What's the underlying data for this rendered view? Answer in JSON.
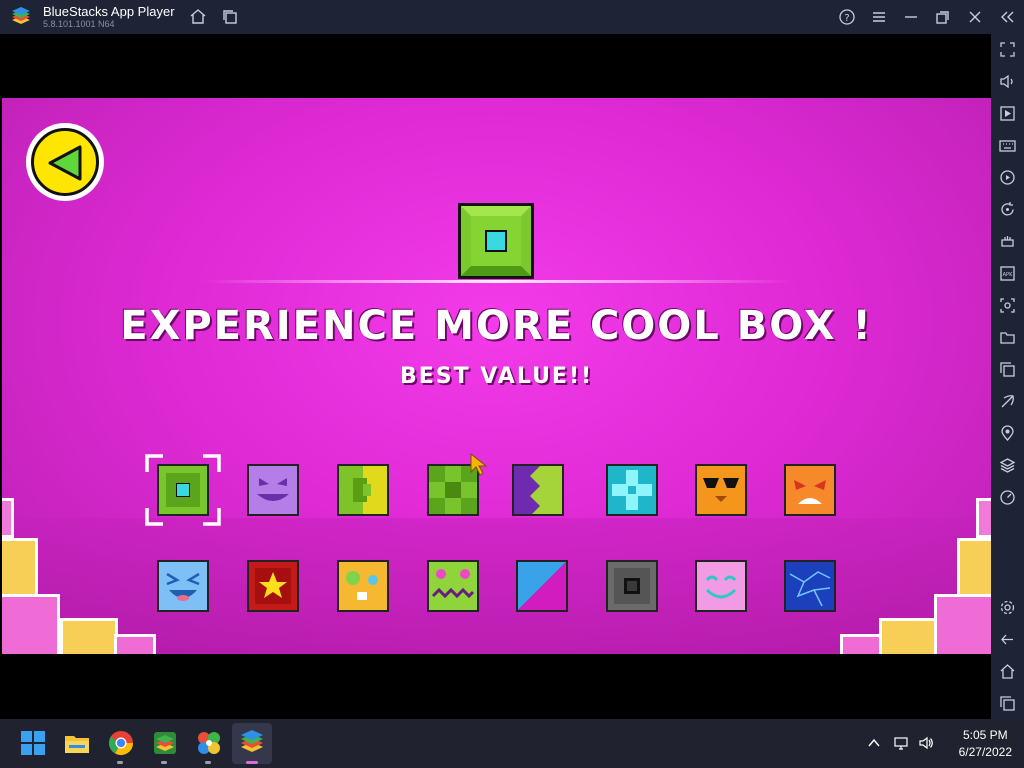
{
  "window": {
    "title": "BlueStacks App Player",
    "version": "5.8.101.1001 N64",
    "icons": [
      "home-icon",
      "multi-instance-icon",
      "help-icon",
      "menu-icon",
      "minimize-icon",
      "restore-icon",
      "close-icon",
      "collapse-sidebar-icon"
    ]
  },
  "sidebar": {
    "icons": [
      "fullscreen-icon",
      "volume-icon",
      "media-icon",
      "keyboard-icon",
      "macro-icon",
      "rotate-icon",
      "game-controls-icon",
      "apk-icon",
      "screenshot-icon",
      "folder-icon",
      "multi-instance-manager-icon",
      "eco-mode-icon",
      "location-icon",
      "layers-icon",
      "performance-icon",
      "settings-icon",
      "back-icon",
      "home-icon",
      "recent-apps-icon"
    ]
  },
  "game": {
    "headline": "EXPERIENCE MORE COOL BOX !",
    "subline": "BEST VALUE!!",
    "back_icon": "back-arrow-icon",
    "cubes_row1": [
      "green-cyan-cube",
      "purple-grin-cube",
      "yellow-green-cube",
      "green-cross-cube",
      "purple-zigzag-cube",
      "cyan-cross-cube",
      "orange-sunglasses-cube",
      "orange-angry-cube"
    ],
    "cubes_row2": [
      "blue-happy-cube",
      "red-star-cube",
      "yellow-dots-cube",
      "green-monster-cube",
      "blue-magenta-split-cube",
      "gray-square-cube",
      "pink-smile-cube",
      "blue-crack-cube"
    ]
  },
  "taskbar": {
    "apps": [
      "windows-start-icon",
      "file-explorer-icon",
      "chrome-icon",
      "bluestacks-store-icon",
      "pinwheel-app-icon",
      "bluestacks-icon"
    ],
    "tray": [
      "chevron-up-icon",
      "network-icon",
      "speaker-icon"
    ],
    "time": "5:05 PM",
    "date": "6/27/2022"
  }
}
